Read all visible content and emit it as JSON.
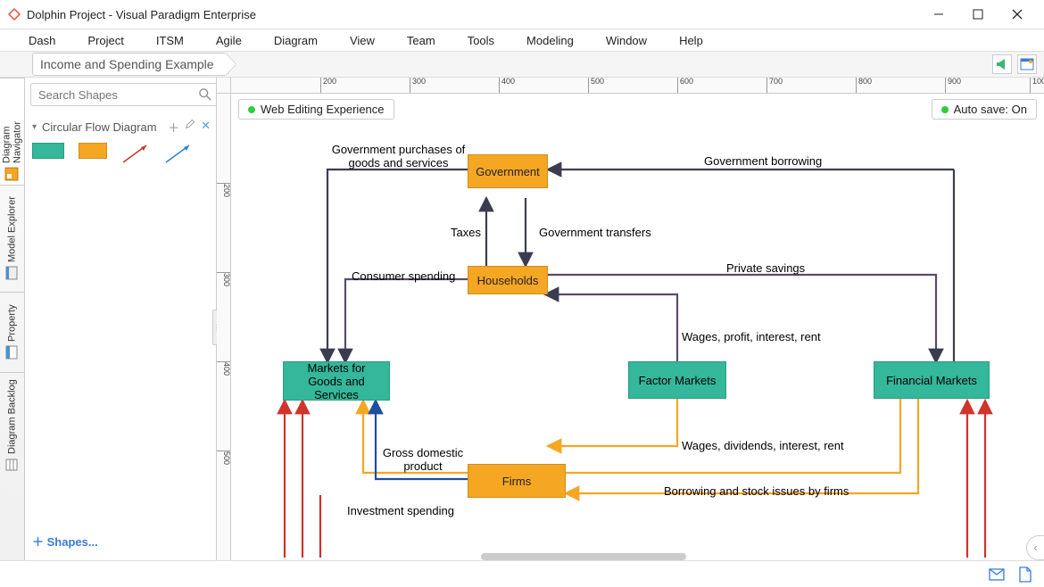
{
  "window": {
    "title": "Dolphin Project - Visual Paradigm Enterprise"
  },
  "menu": [
    "Dash",
    "Project",
    "ITSM",
    "Agile",
    "Diagram",
    "View",
    "Team",
    "Tools",
    "Modeling",
    "Window",
    "Help"
  ],
  "breadcrumb": "Income and Spending Example",
  "palette": {
    "search_placeholder": "Search Shapes",
    "category": "Circular Flow Diagram",
    "footer": "Shapes..."
  },
  "vtabs": [
    "Diagram Navigator",
    "Model Explorer",
    "Property",
    "Diagram Backlog"
  ],
  "ruler_h": [
    "200",
    "300",
    "400",
    "500",
    "600",
    "700",
    "800",
    "900",
    "1000"
  ],
  "ruler_v": [
    "200",
    "300",
    "400",
    "500"
  ],
  "pills": {
    "left": "Web Editing Experience",
    "right": "Auto save: On"
  },
  "diagram": {
    "nodes": {
      "government": "Government",
      "households": "Households",
      "markets_goods": "Markets for Goods and Services",
      "factor_markets": "Factor Markets",
      "financial_markets": "Financial Markets",
      "firms": "Firms"
    },
    "edges": {
      "gov_purchases": "Government purchases of goods and services",
      "gov_borrowing": "Government borrowing",
      "taxes": "Taxes",
      "gov_transfers": "Government transfers",
      "consumer_spending": "Consumer spending",
      "private_savings": "Private savings",
      "wages_profit": "Wages, profit, interest, rent",
      "wages_dividends": "Wages, dividends, interest, rent",
      "gdp": "Gross domestic product",
      "investment_spending": "Investment spending",
      "borrowing_stock": "Borrowing and stock issues by firms"
    }
  }
}
